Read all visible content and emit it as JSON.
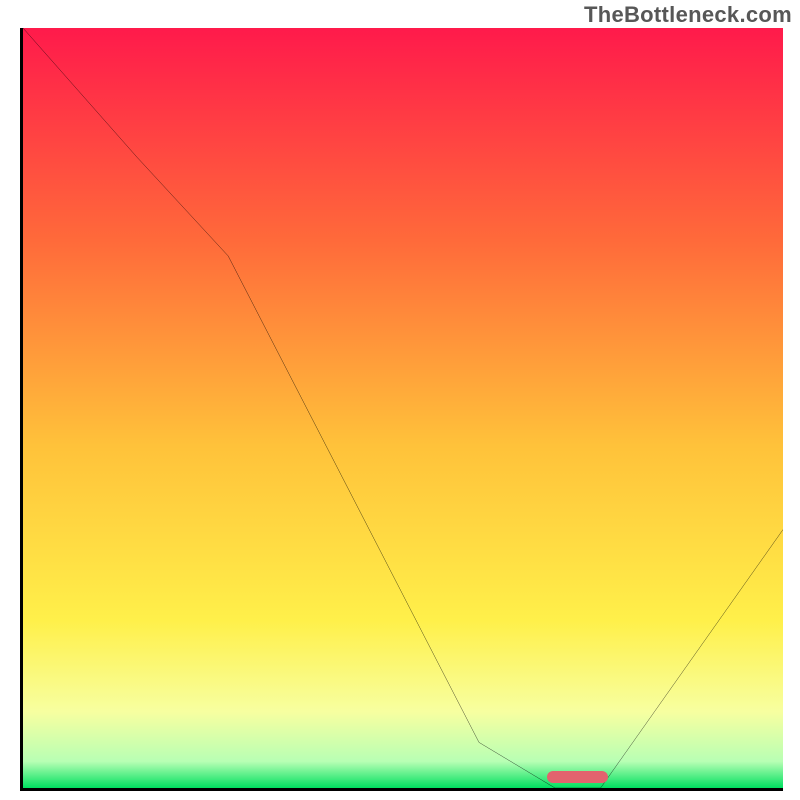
{
  "watermark": "TheBottleneck.com",
  "chart_data": {
    "type": "line",
    "title": "",
    "xlabel": "",
    "ylabel": "",
    "xlim": [
      0,
      100
    ],
    "ylim": [
      0,
      100
    ],
    "grid": false,
    "legend": false,
    "background_gradient": {
      "stops": [
        {
          "pos": 0.0,
          "color": "#ff1a4b"
        },
        {
          "pos": 0.28,
          "color": "#ff6a3a"
        },
        {
          "pos": 0.55,
          "color": "#ffc23a"
        },
        {
          "pos": 0.78,
          "color": "#fff04a"
        },
        {
          "pos": 0.9,
          "color": "#f7ffa0"
        },
        {
          "pos": 0.965,
          "color": "#b8ffb4"
        },
        {
          "pos": 1.0,
          "color": "#00e060"
        }
      ]
    },
    "series": [
      {
        "name": "bottleneck-curve",
        "x": [
          0.0,
          15.0,
          27.0,
          60.0,
          70.0,
          76.0,
          100.0
        ],
        "y": [
          100.0,
          83.0,
          70.0,
          6.0,
          0.0,
          0.0,
          34.0
        ]
      }
    ],
    "marker": {
      "name": "optimal-range",
      "x_start": 69.0,
      "x_end": 77.0,
      "y": 0.6,
      "color": "#e2636e"
    }
  }
}
